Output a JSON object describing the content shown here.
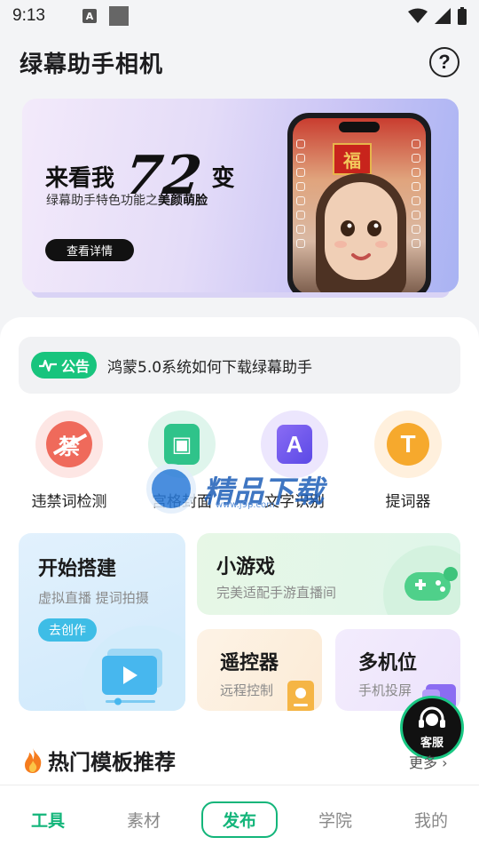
{
  "status_bar": {
    "time": "9:13",
    "a_icon_label": "A"
  },
  "header": {
    "title": "绿幕助手相机"
  },
  "banner": {
    "headline_prefix": "来看我",
    "headline_big": "72",
    "headline_suffix": "变",
    "subtitle_prefix": "绿幕助手特色功能之",
    "subtitle_bold": "美颜萌脸",
    "button": "查看详情",
    "phone_decoration": "福"
  },
  "notice": {
    "badge": "公告",
    "text": "鸿蒙5.0系统如何下载绿幕助手"
  },
  "tools": [
    {
      "label": "违禁词检测",
      "glyph": "禁"
    },
    {
      "label": "宫格封面",
      "glyph": "▣"
    },
    {
      "label": "文字识别",
      "glyph": "A"
    },
    {
      "label": "提词器",
      "glyph": "T"
    }
  ],
  "watermark": {
    "text": "精品下载",
    "url": "www.j9p.com"
  },
  "features": {
    "start": {
      "title": "开始搭建",
      "subtitle": "虚拟直播 提词拍摄",
      "button": "去创作"
    },
    "games": {
      "title": "小游戏",
      "subtitle": "完美适配手游直播间"
    },
    "remote": {
      "title": "遥控器",
      "subtitle": "远程控制"
    },
    "multicam": {
      "title": "多机位",
      "subtitle": "手机投屏"
    }
  },
  "hot": {
    "title": "热门模板推荐",
    "more": "更多"
  },
  "customer_service": {
    "label": "客服"
  },
  "nav": {
    "tools": "工具",
    "materials": "素材",
    "publish": "发布",
    "academy": "学院",
    "mine": "我的"
  },
  "colors": {
    "accent": "#13b57a",
    "notice_green": "#18c47d"
  }
}
